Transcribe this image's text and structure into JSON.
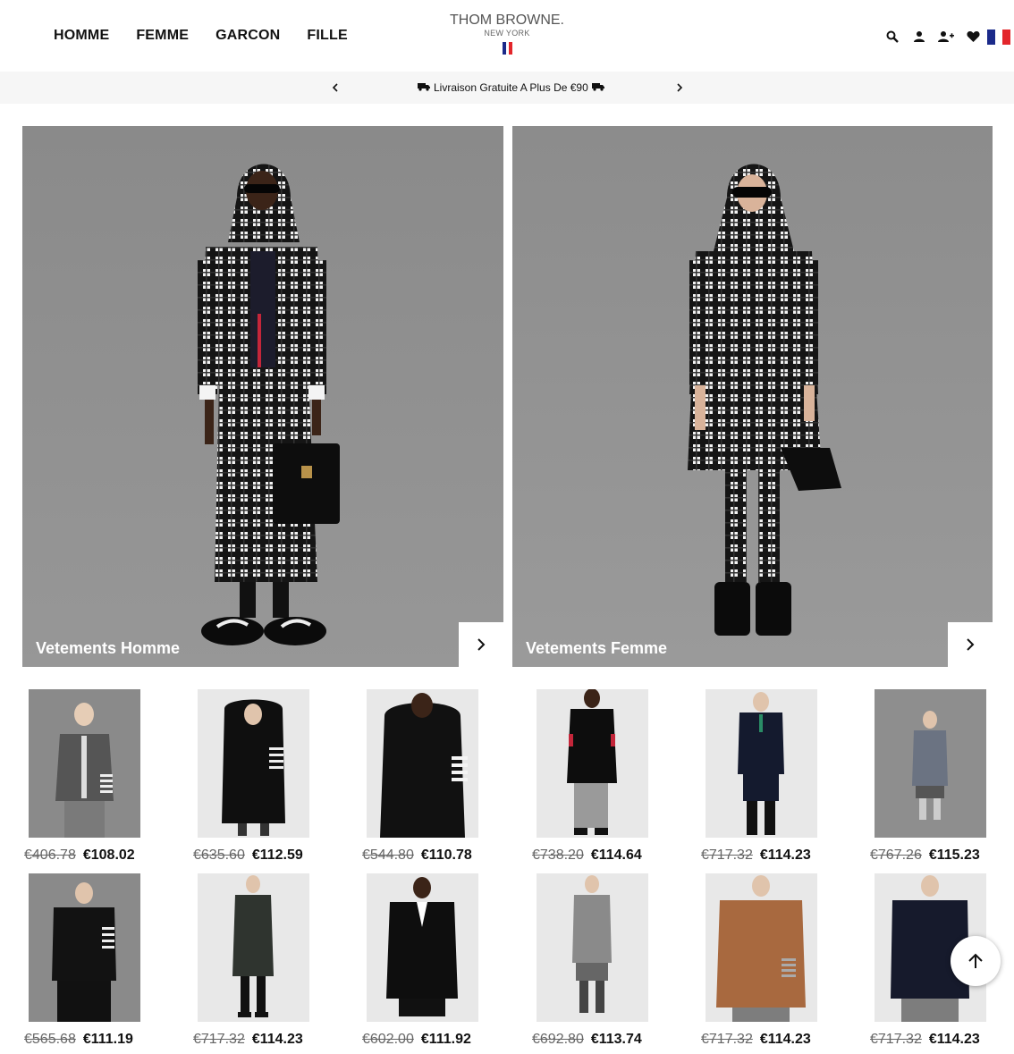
{
  "header": {
    "nav": [
      "HOMME",
      "FEMME",
      "GARCON",
      "FILLE"
    ],
    "logo_main": "THOM BROWNE.",
    "logo_sub": "NEW YORK",
    "icons": [
      "search-icon",
      "account-icon",
      "register-icon",
      "wishlist-icon",
      "france-flag-icon"
    ]
  },
  "promo": {
    "text": "Livraison Gratuite A Plus De €90"
  },
  "banners": [
    {
      "label": "Vetements Homme"
    },
    {
      "label": "Vetements Femme"
    }
  ],
  "products": [
    {
      "old": "€406.78",
      "new": "€108.02"
    },
    {
      "old": "€635.60",
      "new": "€112.59"
    },
    {
      "old": "€544.80",
      "new": "€110.78"
    },
    {
      "old": "€738.20",
      "new": "€114.64"
    },
    {
      "old": "€717.32",
      "new": "€114.23"
    },
    {
      "old": "€767.26",
      "new": "€115.23"
    },
    {
      "old": "€565.68",
      "new": "€111.19"
    },
    {
      "old": "€717.32",
      "new": "€114.23"
    },
    {
      "old": "€602.00",
      "new": "€111.92"
    },
    {
      "old": "€692.80",
      "new": "€113.74"
    },
    {
      "old": "€717.32",
      "new": "€114.23"
    },
    {
      "old": "€717.32",
      "new": "€114.23"
    }
  ],
  "colors": {
    "flag_blue": "#1b2a8a",
    "flag_white": "#ffffff",
    "flag_red": "#e3262b",
    "promo_bg": "#f6f6f6",
    "hero_bg": "#8e8e8e"
  }
}
